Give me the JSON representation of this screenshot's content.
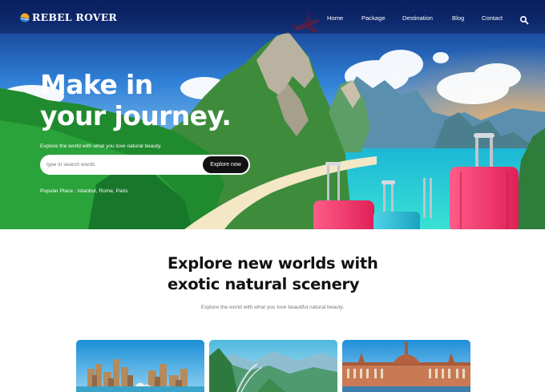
{
  "brand": {
    "name": "REBEL ROVER",
    "logo_icon": "sun-wave-logo"
  },
  "nav": {
    "items": [
      {
        "label": "Home"
      },
      {
        "label": "Package"
      },
      {
        "label": "Destination"
      },
      {
        "label": "Blog"
      },
      {
        "label": "Contact"
      }
    ],
    "search_icon": "search-icon"
  },
  "hero": {
    "title_line1": "Make in",
    "title_line2": "your journey.",
    "subtitle": "Explore the world with what you love natural beauty.",
    "search_placeholder": "type in search words",
    "explore_label": "Explore now",
    "popular_label": "Popular Place : ",
    "popular_places": "Istanbul, Rome, Paris"
  },
  "section": {
    "title_line1": "Explore new worlds with",
    "title_line2": "exotic natural scenery",
    "subtitle": "Explore the world with what you love beautiful natural beauty."
  },
  "cards": [
    {
      "scene": "city-skyline"
    },
    {
      "scene": "mountain-valley"
    },
    {
      "scene": "parliament-building"
    }
  ],
  "colors": {
    "nav_bg": "#0f2a68",
    "sea": "#27d3d9",
    "forest": "#1f8a2e",
    "suitcase_pink": "#f2356a",
    "suitcase_teal": "#2ec0d6",
    "plane": "#d8282e",
    "button_dark": "#111111"
  }
}
